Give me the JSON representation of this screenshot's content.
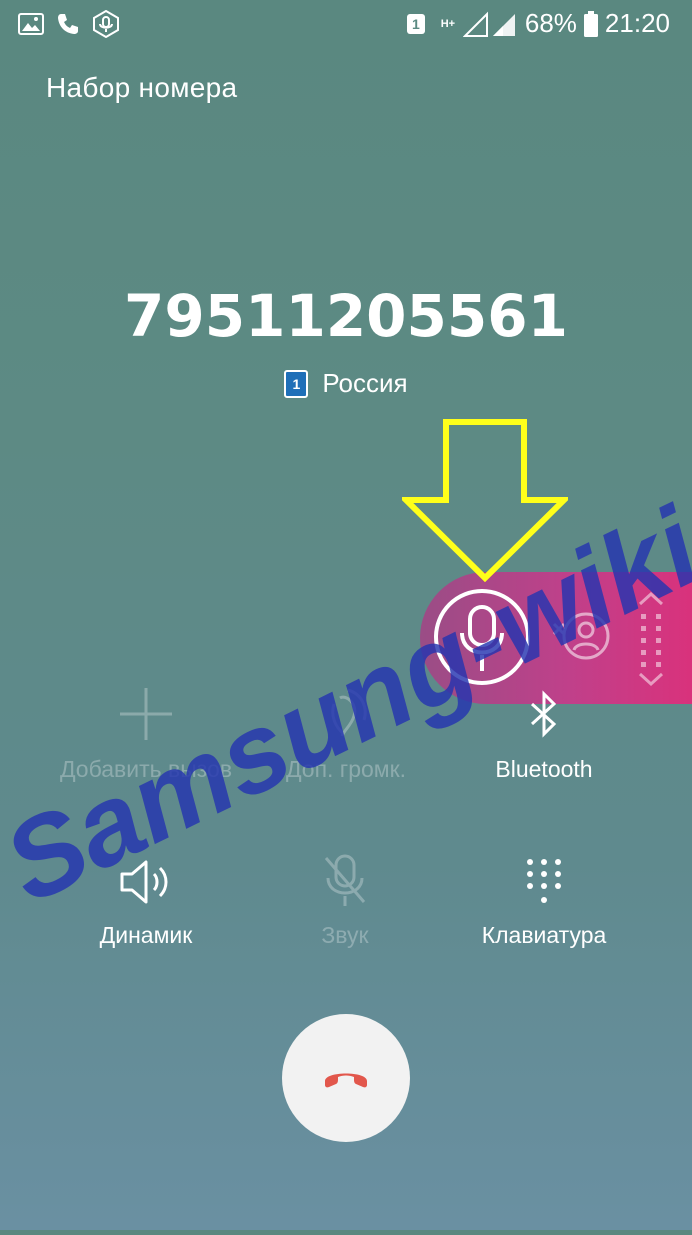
{
  "status_bar": {
    "sim_label": "1",
    "network_type": "H+",
    "battery": "68%",
    "time": "21:20",
    "icons": [
      "gallery-icon",
      "phone-icon",
      "voice-recorder-icon",
      "signal-icon",
      "battery-icon"
    ]
  },
  "header": {
    "title": "Набор номера"
  },
  "call": {
    "number": "79511205561",
    "sim_label": "1",
    "country": "Россия"
  },
  "pull_tab": {
    "icons": [
      "microphone-icon",
      "merge-calls-icon",
      "drag-handle-icon"
    ],
    "color_start": "#9a4d86",
    "color_end": "#d9327c"
  },
  "actions": {
    "add_call": "Добавить вызов",
    "extra_volume": "Доп. громк.",
    "bluetooth": "Bluetooth",
    "speaker": "Динамик",
    "mute": "Звук",
    "keypad": "Клавиатура"
  },
  "end_call": {
    "icon": "end-call-icon",
    "color": "#e2574c"
  },
  "annotation": {
    "arrow_color": "#ffff1a"
  },
  "watermark": {
    "text": "Samsung-wiki",
    "color": "#2535b0"
  }
}
